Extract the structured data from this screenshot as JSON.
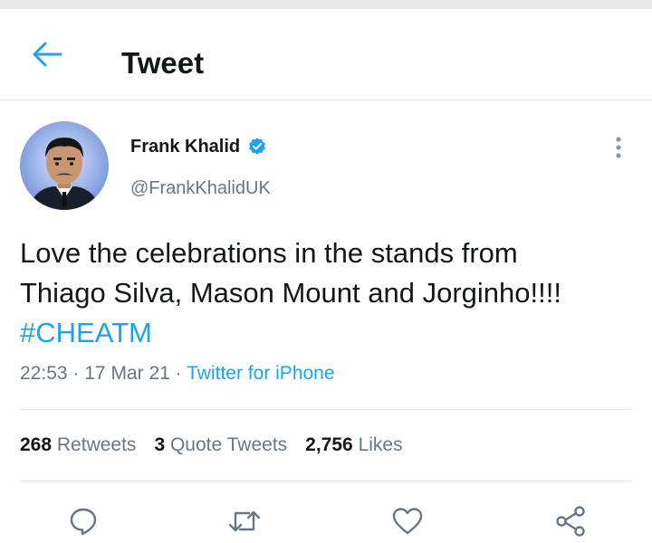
{
  "header": {
    "title": "Tweet"
  },
  "tweet": {
    "author_name": "Frank Khalid",
    "author_handle": "@FrankKhalidUK",
    "text_lines": [
      "Love the celebrations in the stands from",
      "Thiago Silva, Mason Mount and Jorginho!!!!"
    ],
    "hashtag": "#CHEATM",
    "time": "22:53",
    "separator": "·",
    "date": "17 Mar 21",
    "source": "Twitter for iPhone"
  },
  "stats": {
    "retweets_count": "268",
    "retweets_label": "Retweets",
    "quotes_count": "3",
    "quotes_label": "Quote Tweets",
    "likes_count": "2,756",
    "likes_label": "Likes"
  },
  "icons": {
    "back": "arrow-left-icon",
    "verified": "verified-badge-icon",
    "more": "more-vertical-icon",
    "reply": "reply-icon",
    "retweet": "retweet-icon",
    "like": "heart-icon",
    "share": "share-icon"
  },
  "colors": {
    "accent": "#1da1f2",
    "text": "#14171a",
    "secondary": "#657786",
    "divider": "#e1e8ed"
  }
}
